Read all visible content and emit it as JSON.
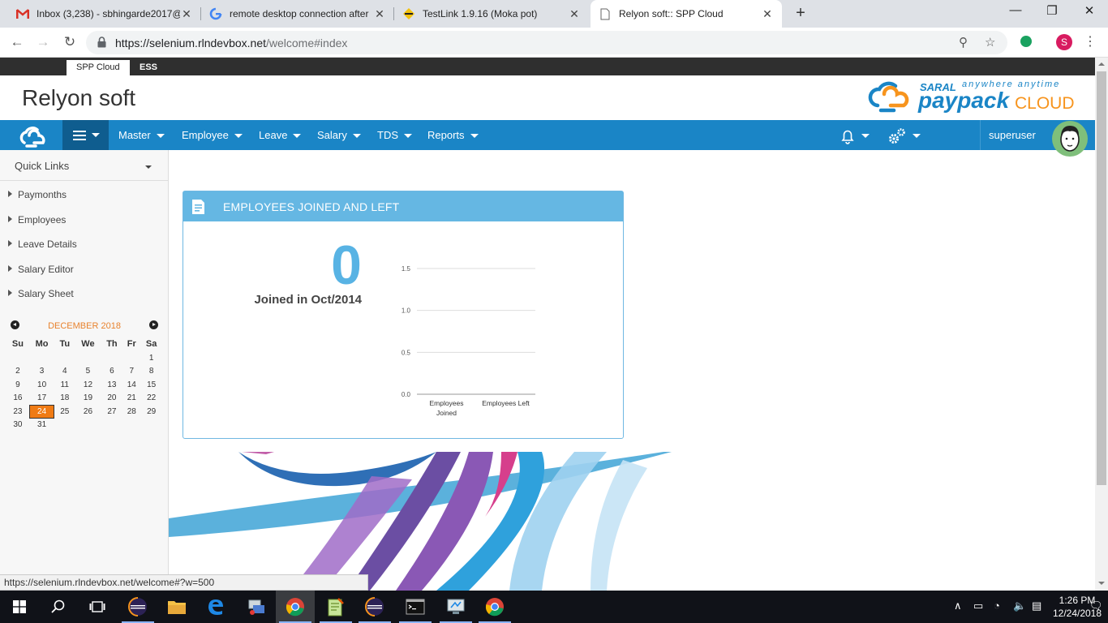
{
  "browser": {
    "tabs": [
      {
        "title": "Inbox (3,238) - sbhingarde2017@",
        "icon": "gmail-icon"
      },
      {
        "title": "remote desktop connection after",
        "icon": "google-icon"
      },
      {
        "title": "TestLink 1.9.16 (Moka pot)",
        "icon": "testlink-icon"
      },
      {
        "title": "Relyon soft:: SPP Cloud",
        "icon": "page-icon"
      }
    ],
    "url_host": "https://selenium.rlndevbox.net",
    "url_path": "/welcome#index",
    "profile_initial": "S",
    "status_url": "https://selenium.rlndevbox.net/welcome#?w=500"
  },
  "app": {
    "top_tabs": [
      "SPP Cloud",
      "ESS"
    ],
    "brand": "Relyon soft",
    "logo": {
      "saral": "SARAL",
      "tagline": "anywhere anytime",
      "paypack": "paypack",
      "cloud": "CLOUD"
    },
    "menu": [
      "Master",
      "Employee",
      "Leave",
      "Salary",
      "TDS",
      "Reports"
    ],
    "username": "superuser",
    "colors": {
      "nav": "#1a85c6",
      "nav_dark": "#0f5d8f",
      "widget_header": "#65b7e3",
      "accent_orange": "#f07b14"
    }
  },
  "sidebar": {
    "quick_links_label": "Quick Links",
    "items": [
      "Paymonths",
      "Employees",
      "Leave Details",
      "Salary Editor",
      "Salary Sheet"
    ]
  },
  "calendar": {
    "month": "DECEMBER 2018",
    "weekdays": [
      "Su",
      "Mo",
      "Tu",
      "We",
      "Th",
      "Fr",
      "Sa"
    ],
    "weeks": [
      [
        "",
        "",
        "",
        "",
        "",
        "",
        "1"
      ],
      [
        "2",
        "3",
        "4",
        "5",
        "6",
        "7",
        "8"
      ],
      [
        "9",
        "10",
        "11",
        "12",
        "13",
        "14",
        "15"
      ],
      [
        "16",
        "17",
        "18",
        "19",
        "20",
        "21",
        "22"
      ],
      [
        "23",
        "24",
        "25",
        "26",
        "27",
        "28",
        "29"
      ],
      [
        "30",
        "31",
        "",
        "",
        "",
        "",
        ""
      ]
    ],
    "today": "24"
  },
  "widget": {
    "title": "EMPLOYEES JOINED AND LEFT",
    "big_number": "0",
    "caption": "Joined in Oct/2014"
  },
  "chart_data": {
    "type": "bar",
    "categories": [
      "Employees Joined",
      "Employees Left"
    ],
    "values": [
      0,
      0
    ],
    "ylim": [
      0,
      1.5
    ],
    "yticks": [
      "0.0",
      "0.5",
      "1.0",
      "1.5"
    ],
    "grid": true
  },
  "taskbar": {
    "apps": [
      "start-icon",
      "search-icon",
      "task-view-icon",
      "eclipse-icon",
      "file-explorer-icon",
      "edge-icon",
      "network-icon",
      "chrome-icon",
      "notepad-icon",
      "eclipse-icon",
      "cmd-icon",
      "remote-desktop-icon",
      "chrome-icon"
    ],
    "time": "1:26 PM",
    "date": "12/24/2018"
  }
}
